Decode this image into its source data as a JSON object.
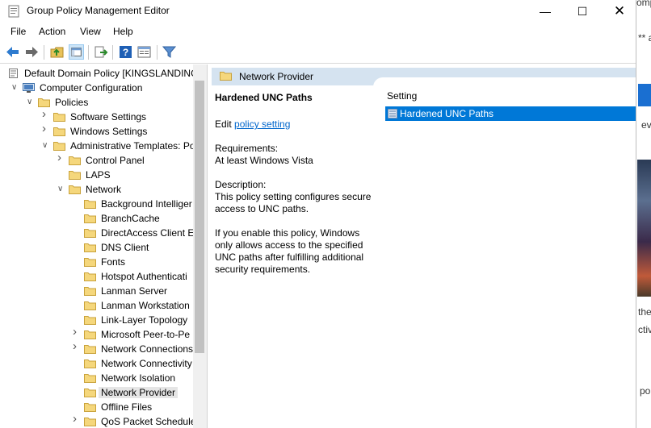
{
  "window": {
    "title": "Group Policy Management Editor"
  },
  "menu": [
    "File",
    "Action",
    "View",
    "Help"
  ],
  "tree": [
    {
      "label": "Default Domain Policy [KINGSLANDING",
      "indent": 0,
      "chev": "",
      "icon": "policy"
    },
    {
      "label": "Computer Configuration",
      "indent": 1,
      "chev": "v",
      "icon": "computer"
    },
    {
      "label": "Policies",
      "indent": 2,
      "chev": "v",
      "icon": "folder"
    },
    {
      "label": "Software Settings",
      "indent": 3,
      "chev": ">",
      "icon": "folder"
    },
    {
      "label": "Windows Settings",
      "indent": 3,
      "chev": ">",
      "icon": "folder"
    },
    {
      "label": "Administrative Templates: Po",
      "indent": 3,
      "chev": "v",
      "icon": "folder"
    },
    {
      "label": "Control Panel",
      "indent": 4,
      "chev": ">",
      "icon": "folder"
    },
    {
      "label": "LAPS",
      "indent": 4,
      "chev": "",
      "icon": "folder"
    },
    {
      "label": "Network",
      "indent": 4,
      "chev": "v",
      "icon": "folder"
    },
    {
      "label": "Background Intelliger",
      "indent": 5,
      "chev": "",
      "icon": "folder"
    },
    {
      "label": "BranchCache",
      "indent": 5,
      "chev": "",
      "icon": "folder"
    },
    {
      "label": "DirectAccess Client Ex",
      "indent": 5,
      "chev": "",
      "icon": "folder"
    },
    {
      "label": "DNS Client",
      "indent": 5,
      "chev": "",
      "icon": "folder"
    },
    {
      "label": "Fonts",
      "indent": 5,
      "chev": "",
      "icon": "folder"
    },
    {
      "label": "Hotspot Authenticati",
      "indent": 5,
      "chev": "",
      "icon": "folder"
    },
    {
      "label": "Lanman Server",
      "indent": 5,
      "chev": "",
      "icon": "folder"
    },
    {
      "label": "Lanman Workstation",
      "indent": 5,
      "chev": "",
      "icon": "folder"
    },
    {
      "label": "Link-Layer Topology",
      "indent": 5,
      "chev": "",
      "icon": "folder"
    },
    {
      "label": "Microsoft Peer-to-Pe",
      "indent": 5,
      "chev": ">",
      "icon": "folder"
    },
    {
      "label": "Network Connections",
      "indent": 5,
      "chev": ">",
      "icon": "folder"
    },
    {
      "label": "Network Connectivity",
      "indent": 5,
      "chev": "",
      "icon": "folder"
    },
    {
      "label": "Network Isolation",
      "indent": 5,
      "chev": "",
      "icon": "folder"
    },
    {
      "label": "Network Provider",
      "indent": 5,
      "chev": "",
      "icon": "folder",
      "selected": true
    },
    {
      "label": "Offline Files",
      "indent": 5,
      "chev": "",
      "icon": "folder"
    },
    {
      "label": "QoS Packet Schedule",
      "indent": 5,
      "chev": ">",
      "icon": "folder"
    }
  ],
  "panel": {
    "header": "Network Provider",
    "policy_name": "Hardened UNC Paths",
    "edit_prefix": "Edit",
    "edit_link": "policy setting",
    "requirements_label": "Requirements:",
    "requirements_value": "At least Windows Vista",
    "description_label": "Description:",
    "description_lines": [
      "This policy setting configures secure",
      "access to UNC paths."
    ],
    "enable_lines": [
      "If you enable this policy, Windows",
      "only allows access to the specified",
      "UNC paths after fulfilling additional",
      "security requirements."
    ]
  },
  "list": {
    "column": "Setting",
    "selected_item": "Hardened UNC Paths"
  },
  "background_fragments": [
    "omp",
    "** a",
    "ev",
    "the",
    "ctiv",
    "po"
  ]
}
